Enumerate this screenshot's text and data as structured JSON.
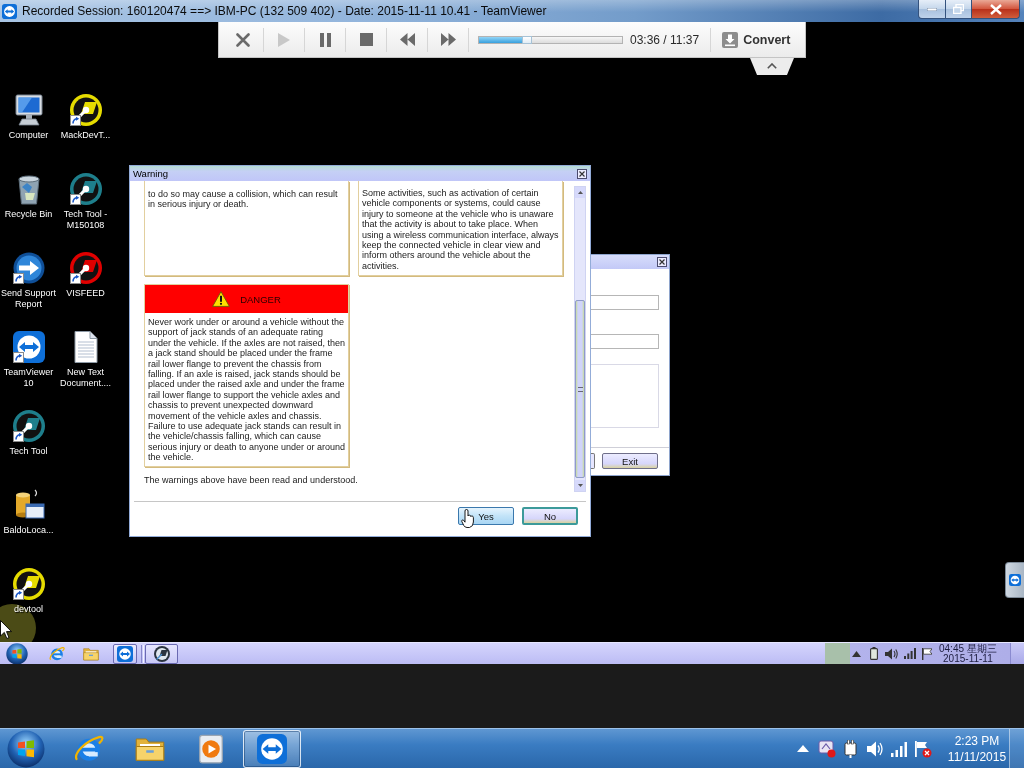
{
  "window": {
    "title": "Recorded Session: 160120474 ==> IBM-PC (132 509 402) - Date: 2015-11-11 10.41 - TeamViewer"
  },
  "player": {
    "controls": [
      {
        "kind": "close",
        "disabled": false
      },
      {
        "kind": "play",
        "disabled": true
      },
      {
        "kind": "pause",
        "disabled": false
      },
      {
        "kind": "stop",
        "disabled": false
      },
      {
        "kind": "rewind",
        "disabled": false
      },
      {
        "kind": "forward",
        "disabled": false
      }
    ],
    "progress": {
      "level": 0.31
    },
    "time": "03:36 / 11:37",
    "convert": "Convert"
  },
  "desktop": {
    "columns": [
      [
        {
          "kind": "computer",
          "label": "Computer",
          "shortcut": false
        },
        {
          "kind": "recycle-bin",
          "label": "Recycle Bin",
          "shortcut": false
        },
        {
          "kind": "support",
          "label": "Send Support Report",
          "shortcut": true
        },
        {
          "kind": "teamviewer",
          "label": "TeamViewer 10",
          "shortcut": true
        },
        {
          "kind": "tool",
          "color": "#1e7f8c",
          "label": "Tech Tool",
          "shortcut": true
        },
        {
          "kind": "package",
          "label": "BaldoLoca...",
          "shortcut": false
        },
        {
          "kind": "tool",
          "color": "#e6dc00",
          "label": "devtool",
          "shortcut": true
        }
      ],
      [
        {
          "kind": "tool",
          "color": "#e6dc00",
          "label": "MackDevT...",
          "shortcut": true
        },
        {
          "kind": "tool",
          "color": "#1e7f8c",
          "label": "Tech Tool - M150108",
          "shortcut": true
        },
        {
          "kind": "tool",
          "color": "#e00000",
          "label": "VISFEED",
          "shortcut": true
        },
        {
          "kind": "text-document",
          "label": "New Text Document....",
          "shortcut": false
        }
      ]
    ]
  },
  "warning_dialog": {
    "title": "Warning",
    "panels": [
      {
        "kind": "note",
        "text": "to do so may cause a collision, which can result in serious injury or death."
      },
      {
        "kind": "note",
        "text": "Some activities, such as activation of certain vehicle components or systems, could cause injury to someone at the vehicle who is unaware that the activity is about to take place. When using a wireless communication interface, always keep the connected vehicle in clear view and inform others around the vehicle about the activities."
      },
      {
        "kind": "danger",
        "heading": "DANGER",
        "text": "Never work under or around a vehicle without the support of jack stands of an adequate rating under the vehicle. If the axles are not raised, then a jack stand should be placed under the frame rail lower flange to prevent the chassis from falling. If an axle is raised, jack stands should be placed under the raised axle and under the frame rail lower flange to support the vehicle axles and chassis to prevent unexpected downward movement of the vehicle axles and chassis. Failure to use adequate jack stands can result in the vehicle/chassis falling, which can cause serious injury or death to anyone under or around the vehicle."
      }
    ],
    "acknowledgement": "The warnings above have been read and understood.",
    "buttons": [
      {
        "label": "Yes",
        "hovered": true,
        "default": false
      },
      {
        "label": "No",
        "hovered": false,
        "default": true
      }
    ]
  },
  "background_window": {
    "buttons": [
      "Exit"
    ]
  },
  "remote_taskbar": {
    "quick_launch": [
      {
        "kind": "ie",
        "pressed": false
      },
      {
        "kind": "folder",
        "pressed": false
      },
      {
        "kind": "teamviewer",
        "pressed": true
      }
    ],
    "tasks": [
      {
        "kind": "tool"
      }
    ],
    "clock": {
      "time": "04:45 星期三",
      "date": "2015-11-11"
    }
  },
  "taskbar": {
    "items": [
      {
        "kind": "ie",
        "active": false
      },
      {
        "kind": "explorer",
        "active": false
      },
      {
        "kind": "media-player",
        "active": false
      },
      {
        "kind": "teamviewer",
        "active": true
      }
    ],
    "clock": {
      "time": "2:23 PM",
      "date": "11/11/2015"
    }
  }
}
